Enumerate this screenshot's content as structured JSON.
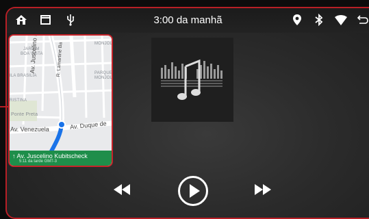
{
  "status_bar": {
    "time": "3:00 da manhã",
    "left_icons": [
      "home-icon",
      "recent-apps-icon",
      "usb-icon"
    ],
    "right_icons": [
      "location-pin-icon",
      "bluetooth-icon",
      "wifi-icon",
      "back-icon"
    ]
  },
  "map": {
    "labels": {
      "jardim": "JARDIM",
      "boa_vista": "BOA VISTA",
      "vila_brasilia": "ILA BRASILIA",
      "cristina": "RISTINA",
      "parque_monjolo": "PARQUE",
      "monjolo": "MONJOL",
      "monjolo_top": "MONJOL",
      "ponte_preta": "Ponte Preta"
    },
    "streets": {
      "kubitscheck": "Av. Juscelino Kubitscheck",
      "lamartine": "R. Lamartine Ba",
      "venezuela": "Av. Venezuela",
      "duque": "Av. Duque de"
    },
    "navigation": {
      "arrow": "↑",
      "street": "Av. Juscelino Kubitscheck",
      "eta": "5:11 da tarde GMT-3"
    }
  },
  "media": {
    "album_art_icon": "music-note-icon",
    "controls": {
      "previous": "previous-track-icon",
      "play": "play-icon",
      "next": "next-track-icon"
    }
  },
  "colors": {
    "accent_red": "#c8232a",
    "nav_green": "#1e8e4a",
    "route_blue": "#1a73e8"
  }
}
